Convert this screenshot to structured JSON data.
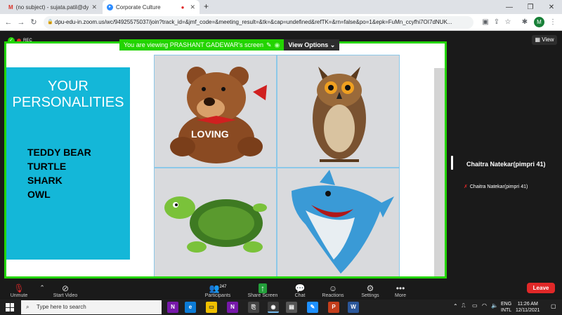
{
  "browser": {
    "tabs": [
      {
        "title": "(no subject) - sujata.patil@dypvp",
        "icon": "gmail-icon"
      },
      {
        "title": "Corporate Culture",
        "icon": "zoom-icon"
      }
    ],
    "new_tab": "+",
    "address": "dpu-edu-in.zoom.us/wc/94925575037/join?track_id=&jmf_code=&meeting_result=&tk=&cap=undefined&refTK=&rn=false&po=1&epk=FuMn_ccyfhi7OI7dNUK...",
    "profile_initial": "M"
  },
  "meeting": {
    "rec_label": "REC",
    "share_banner": "You are viewing PRASHANT GADEWAR's screen",
    "view_options": "View Options",
    "view_button": "View",
    "slide": {
      "title_line1": "YOUR",
      "title_line2": "PERSONALITIES",
      "items": [
        "TEDDY BEAR",
        "TURTLE",
        "SHARK",
        "OWL"
      ],
      "teddy_caption": "LOVING"
    },
    "participant": {
      "tile_name": "Chaitra Natekar(pimpri 41)",
      "label_name": "Chaitra Natekar(pimpri 41)"
    }
  },
  "zoom_toolbar": {
    "unmute": "Unmute",
    "start_video": "Start Video",
    "participants": "Participants",
    "participants_count": "247",
    "share_screen": "Share Screen",
    "chat": "Chat",
    "reactions": "Reactions",
    "settings": "Settings",
    "more": "More",
    "leave": "Leave"
  },
  "taskbar": {
    "search_placeholder": "Type here to search",
    "lang_line1": "ENG",
    "lang_line2": "INTL",
    "time": "11:26 AM",
    "date": "12/11/2021"
  },
  "colors": {
    "share_border": "#23d400",
    "slide_panel": "#14b7d8",
    "leave": "#e02828"
  }
}
